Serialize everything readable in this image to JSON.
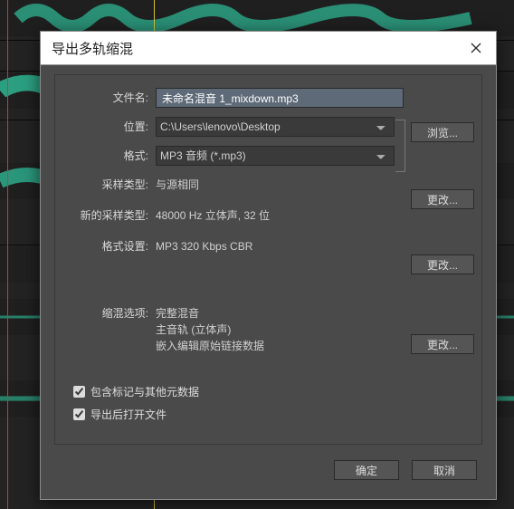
{
  "dialog": {
    "title": "导出多轨缩混",
    "labels": {
      "filename": "文件名:",
      "location": "位置:",
      "format": "格式:",
      "sample_type": "采样类型:",
      "new_sample_type": "新的采样类型:",
      "format_settings": "格式设置:",
      "mixdown_options": "缩混选项:"
    },
    "values": {
      "filename": "未命名混音 1_mixdown.mp3",
      "location": "C:\\Users\\lenovo\\Desktop",
      "format": "MP3 音频 (*.mp3)",
      "sample_type": "与源相同",
      "new_sample_type": "48000 Hz 立体声, 32 位",
      "format_settings": "MP3 320 Kbps CBR",
      "mixdown_options": "完整混音\n主音轨 (立体声)\n嵌入编辑原始链接数据"
    },
    "buttons": {
      "browse": "浏览...",
      "change": "更改...",
      "ok": "确定",
      "cancel": "取消"
    },
    "checkboxes": {
      "include_metadata": "包含标记与其他元数据",
      "open_after": "导出后打开文件"
    }
  }
}
